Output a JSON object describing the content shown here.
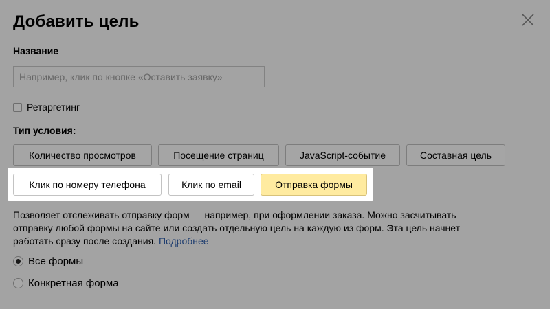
{
  "dialog": {
    "title": "Добавить цель",
    "close_icon": "close-icon"
  },
  "name_field": {
    "label": "Название",
    "value": "",
    "placeholder": "Например, клик по кнопке «Оставить заявку»"
  },
  "retargeting": {
    "label": "Ретаргетинг",
    "checked": false
  },
  "condition": {
    "label": "Тип условия:",
    "types": [
      "Количество просмотров",
      "Посещение страниц",
      "JavaScript-событие",
      "Составная цель",
      "Клик по номеру телефона",
      "Клик по email",
      "Отправка формы"
    ],
    "selected": "Отправка формы"
  },
  "description": {
    "lines": [
      "Позволяет отслеживать отправку форм — например, при оформлении заказа. Можно засчитывать",
      "отправку любой формы на сайте или создать отдельную цель на каждую из форм. Эта цель начнет",
      "работать сразу после создания."
    ],
    "link": "Подробнее"
  },
  "form_scope": {
    "options": [
      "Все формы",
      "Конкретная форма"
    ],
    "selected": "Все формы"
  },
  "colors": {
    "overlay": "#a3a3a3",
    "highlight": "#ffffff",
    "active_button": "#ffeba0",
    "link": "#1a3a6e"
  }
}
